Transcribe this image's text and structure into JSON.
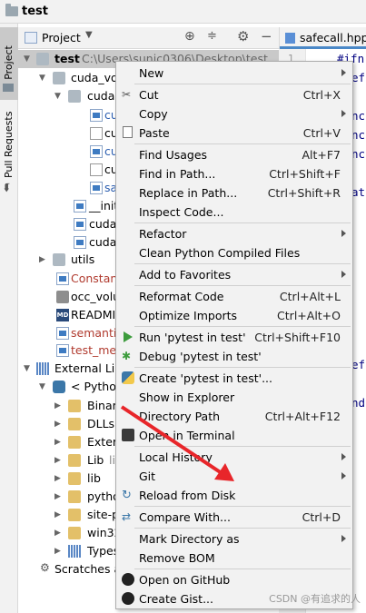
{
  "window": {
    "title": "test"
  },
  "left_strip": {
    "project_tab": "1: Project",
    "pull_requests_tab": "Pull Requests"
  },
  "project_toolbar": {
    "view_selector": "Project"
  },
  "editor": {
    "tab_name": "safecall.hpp",
    "lines": [
      "#ifn",
      "ef",
      "nc",
      "nc",
      "nc",
      "at",
      "ef",
      "nd"
    ]
  },
  "tree": [
    {
      "label": "test",
      "suffix": "C:\\Users\\sunic0306\\Desktop\\test"
    },
    {
      "label": "cuda_vo"
    },
    {
      "label": "cuda"
    },
    {
      "label": "cu"
    },
    {
      "label": "cu"
    },
    {
      "label": "cu"
    },
    {
      "label": "cu"
    },
    {
      "label": "sa"
    },
    {
      "label": "__init_"
    },
    {
      "label": "cuda_"
    },
    {
      "label": "cuda_"
    },
    {
      "label": "utils"
    },
    {
      "label": "Constan"
    },
    {
      "label": "occ_volu"
    },
    {
      "label": "READMI"
    },
    {
      "label": "semantic"
    },
    {
      "label": "test_mes"
    },
    {
      "label": "External Lib"
    },
    {
      "label": "< Python"
    },
    {
      "label": "Binar"
    },
    {
      "label": "DLLs"
    },
    {
      "label": "Exter"
    },
    {
      "label": "Lib",
      "suffix": "li"
    },
    {
      "label": "lib"
    },
    {
      "label": "pytho"
    },
    {
      "label": "site-p"
    },
    {
      "label": "win32"
    },
    {
      "label": "Types"
    },
    {
      "label": "Scratches a"
    }
  ],
  "context_menu": {
    "items": [
      {
        "label": "New",
        "shortcut": "",
        "submenu": true
      },
      {
        "label": "Cut",
        "shortcut": "Ctrl+X",
        "icon": "scissors-icon"
      },
      {
        "label": "Copy",
        "shortcut": "",
        "submenu": true
      },
      {
        "label": "Paste",
        "shortcut": "Ctrl+V",
        "icon": "clipboard-icon"
      },
      {
        "label": "Find Usages",
        "shortcut": "Alt+F7"
      },
      {
        "label": "Find in Path...",
        "shortcut": "Ctrl+Shift+F"
      },
      {
        "label": "Replace in Path...",
        "shortcut": "Ctrl+Shift+R"
      },
      {
        "label": "Inspect Code..."
      },
      {
        "label": "Refactor",
        "submenu": true
      },
      {
        "label": "Clean Python Compiled Files"
      },
      {
        "label": "Add to Favorites",
        "submenu": true
      },
      {
        "label": "Reformat Code",
        "shortcut": "Ctrl+Alt+L"
      },
      {
        "label": "Optimize Imports",
        "shortcut": "Ctrl+Alt+O"
      },
      {
        "label": "Run 'pytest in test'",
        "shortcut": "Ctrl+Shift+F10",
        "icon": "run-icon"
      },
      {
        "label": "Debug 'pytest in test'",
        "icon": "debug-icon"
      },
      {
        "label": "Create 'pytest in test'...",
        "icon": "python-icon"
      },
      {
        "label": "Show in Explorer"
      },
      {
        "label": "Directory Path",
        "shortcut": "Ctrl+Alt+F12"
      },
      {
        "label": "Open in Terminal",
        "icon": "terminal-icon"
      },
      {
        "label": "Local History",
        "submenu": true
      },
      {
        "label": "Git",
        "submenu": true
      },
      {
        "label": "Reload from Disk",
        "icon": "reload-icon"
      },
      {
        "label": "Compare With...",
        "shortcut": "Ctrl+D",
        "icon": "compare-icon"
      },
      {
        "label": "Mark Directory as",
        "submenu": true
      },
      {
        "label": "Remove BOM"
      },
      {
        "label": "Open on GitHub",
        "icon": "github-icon"
      },
      {
        "label": "Create Gist...",
        "icon": "github-icon"
      }
    ]
  },
  "watermark": "CSDN @有追求的人",
  "colors": {
    "arrow": "#e8262a",
    "run_green": "#3d9c3d",
    "selection": "#c9c9c9"
  }
}
